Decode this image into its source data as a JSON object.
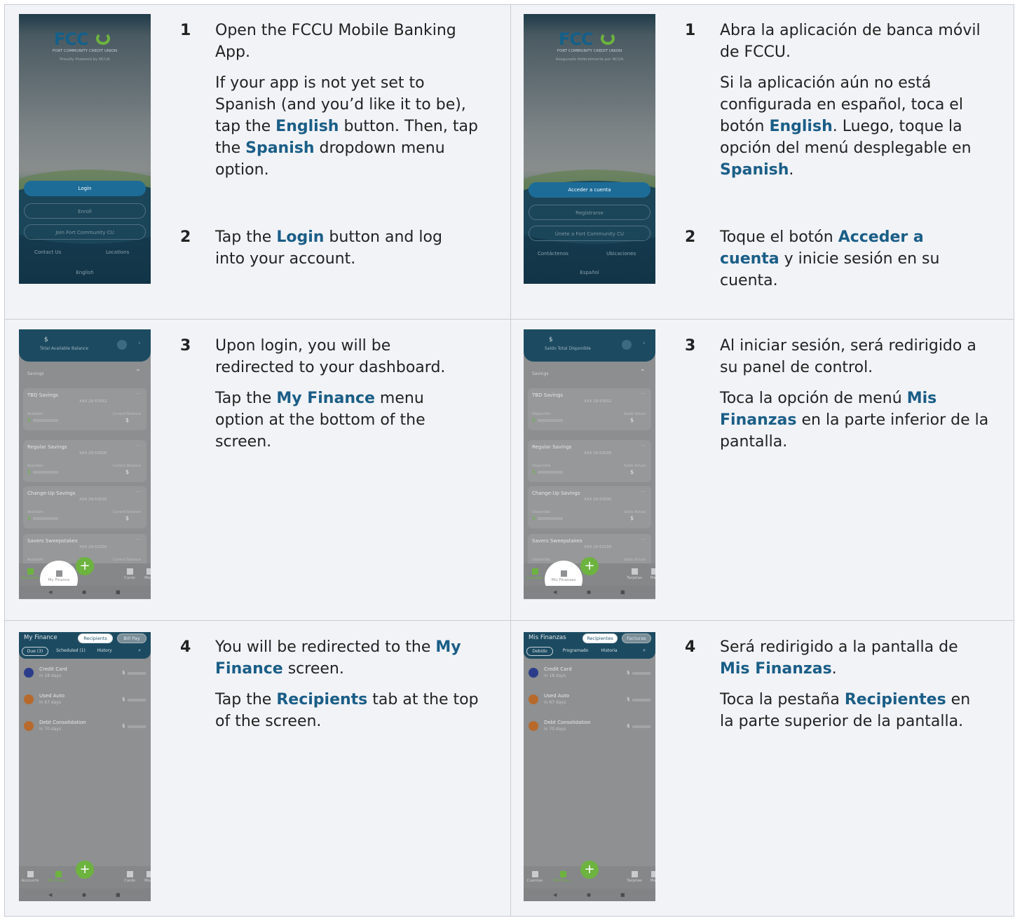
{
  "rows": [
    {
      "en": {
        "steps": [
          {
            "num": "1",
            "paras": [
              [
                {
                  "t": "Open the FCCU Mobile Banking App."
                }
              ],
              [
                {
                  "t": "If your app is not yet set to Spanish (and you’d like it to be), tap the "
                },
                {
                  "t": "English",
                  "hl": true
                },
                {
                  "t": " button. Then, tap the "
                },
                {
                  "t": "Spanish",
                  "hl": true
                },
                {
                  "t": " dropdown menu option."
                }
              ]
            ]
          },
          {
            "num": "2",
            "paras": [
              [
                {
                  "t": "Tap the "
                },
                {
                  "t": "Login",
                  "hl": true
                },
                {
                  "t": " button and log into your account."
                }
              ]
            ]
          }
        ]
      },
      "es": {
        "steps": [
          {
            "num": "1",
            "paras": [
              [
                {
                  "t": "Abra la aplicación de banca móvil de FCCU."
                }
              ],
              [
                {
                  "t": "Si la aplicación aún no está configurada en español, toca el botón "
                },
                {
                  "t": "English",
                  "hl": true
                },
                {
                  "t": ". Luego, toque la opción del menú desplegable en "
                },
                {
                  "t": "Spanish",
                  "hl": true
                },
                {
                  "t": "."
                }
              ]
            ]
          },
          {
            "num": "2",
            "paras": [
              [
                {
                  "t": "Toque el botón "
                },
                {
                  "t": "Acceder a cuenta",
                  "hl": true
                },
                {
                  "t": " y inicie sesión en su cuenta."
                }
              ]
            ]
          }
        ]
      }
    },
    {
      "en": {
        "steps": [
          {
            "num": "3",
            "paras": [
              [
                {
                  "t": "Upon login, you will be redirected to your dashboard."
                }
              ],
              [
                {
                  "t": "Tap the "
                },
                {
                  "t": "My Finance",
                  "hl": true
                },
                {
                  "t": " menu option at the bottom of the screen."
                }
              ]
            ]
          }
        ]
      },
      "es": {
        "steps": [
          {
            "num": "3",
            "paras": [
              [
                {
                  "t": "Al iniciar sesión, será redirigido a su panel de control."
                }
              ],
              [
                {
                  "t": "Toca la opción de menú "
                },
                {
                  "t": "Mis Finanzas",
                  "hl": true
                },
                {
                  "t": " en la parte inferior de la pantalla."
                }
              ]
            ]
          }
        ]
      }
    },
    {
      "en": {
        "steps": [
          {
            "num": "4",
            "paras": [
              [
                {
                  "t": "You will be redirected to the "
                },
                {
                  "t": "My Finance",
                  "hl": true
                },
                {
                  "t": " screen."
                }
              ],
              [
                {
                  "t": "Tap the "
                },
                {
                  "t": "Recipients",
                  "hl": true
                },
                {
                  "t": " tab at the top of the screen."
                }
              ]
            ]
          }
        ]
      },
      "es": {
        "steps": [
          {
            "num": "4",
            "paras": [
              [
                {
                  "t": "Será redirigido a la pantalla de "
                },
                {
                  "t": "Mis Finanzas",
                  "hl": true
                },
                {
                  "t": "."
                }
              ],
              [
                {
                  "t": "Toca la pestaña "
                },
                {
                  "t": "Recipientes",
                  "hl": true
                },
                {
                  "t": " en la parte superior de la pantalla."
                }
              ]
            ]
          }
        ]
      }
    }
  ],
  "screens": {
    "login_en": {
      "brand": "FCC",
      "subtitle": "FORT COMMUNITY CREDIT UNION",
      "tagline": "Proudly Powered by NCUA",
      "login": "Login",
      "enroll": "Enroll",
      "join": "Join Fort Community CU",
      "contact": "Contact Us",
      "locations": "Locations",
      "language": "English"
    },
    "login_es": {
      "brand": "FCC",
      "subtitle": "FORT COMMUNITY CREDIT UNION",
      "tagline": "Asegurado federalmente por NCUA",
      "login": "Acceder a cuenta",
      "enroll": "Registrarse",
      "join": "Únete a Fort Community CU",
      "contact": "Contáctenos",
      "locations": "Ubicaciones",
      "language": "Español"
    },
    "dash_en": {
      "dollar": "$",
      "balance_label": "Total Available Balance",
      "section": "Savings",
      "avail": "Available",
      "current": "Current Balance",
      "accounts": [
        {
          "name": "TBD Savings",
          "acct": "XXX 29-53552"
        },
        {
          "name": "Regular Savings",
          "acct": "XXX 29-53000"
        },
        {
          "name": "Change-Up Savings",
          "acct": "XXX 29-53035"
        },
        {
          "name": "Savers Sweepstakes",
          "acct": "XXX 29-53250"
        }
      ],
      "nav": [
        "Accounts",
        "My Finance",
        "Cards",
        "More"
      ]
    },
    "dash_es": {
      "dollar": "$",
      "balance_label": "Saldo Total Disponible",
      "section": "Savings",
      "avail": "Disponible",
      "current": "Saldo Actual",
      "accounts": [
        {
          "name": "TBD Savings",
          "acct": "XXX 29-53552"
        },
        {
          "name": "Regular Savings",
          "acct": "XXX 29-53000"
        },
        {
          "name": "Change-Up Savings",
          "acct": "XXX 29-53035"
        },
        {
          "name": "Savers Sweepstakes",
          "acct": "XXX 29-53250"
        }
      ],
      "nav": [
        "Cuentas",
        "Mis Finanzas",
        "Tarjetas",
        "Más"
      ]
    },
    "fin_en": {
      "title": "My Finance",
      "tab_recipients": "Recipients",
      "tab_billpay": "Bill Pay",
      "filters": [
        "Due (3)",
        "Scheduled (1)",
        "History"
      ],
      "bills": [
        {
          "name": "Credit Card",
          "due": "in 18 days",
          "color": "#2b3d8a"
        },
        {
          "name": "Used Auto",
          "due": "in 67 days",
          "color": "#b86a2c"
        },
        {
          "name": "Debt Consolidation",
          "due": "in 70 days",
          "color": "#b86a2c"
        }
      ],
      "nav": [
        "Accounts",
        "My Finan...",
        "Cards",
        "More"
      ]
    },
    "fin_es": {
      "title": "Mis Finanzas",
      "tab_recipients": "Recipientes",
      "tab_billpay": "Facturas",
      "filters": [
        "Debido",
        "Programado",
        "Historia"
      ],
      "bills": [
        {
          "name": "Credit Card",
          "due": "in 18 days",
          "color": "#2b3d8a"
        },
        {
          "name": "Used Auto",
          "due": "in 67 days",
          "color": "#b86a2c"
        },
        {
          "name": "Debt Consolidation",
          "due": "in 70 days",
          "color": "#b86a2c"
        }
      ],
      "nav": [
        "Cuentas",
        "Mis Fina...",
        "Tarjetas",
        "Más"
      ]
    }
  },
  "colors": {
    "highlight": "#1a5e87",
    "brand_green": "#6db33f",
    "brand_blue": "#1c4b61"
  }
}
